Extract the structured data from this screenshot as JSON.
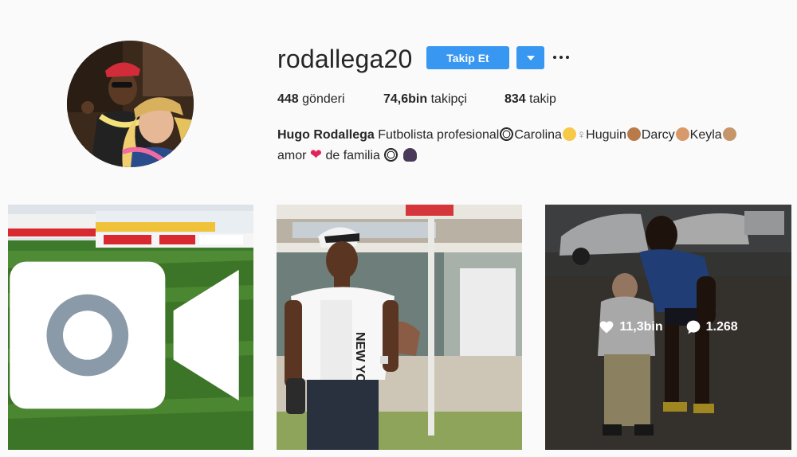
{
  "profile": {
    "username": "rodallega20",
    "follow_label": "Takip Et",
    "stats": {
      "posts_count": "448",
      "posts_label": "gönderi",
      "followers_count": "74,6bin",
      "followers_label": "takipçi",
      "following_count": "834",
      "following_label": "takip"
    },
    "bio": {
      "name": "Hugo Rodallega",
      "text1": "Futbolista profesional",
      "n1": "Carolina",
      "n2": "Huguin",
      "n3": "Darcy",
      "n4": "Keyla",
      "text2": "amor",
      "text3": "de familia"
    }
  },
  "posts": [
    {
      "type": "video",
      "icon": "video-icon"
    },
    {
      "type": "photo"
    },
    {
      "type": "photo",
      "hovered": true,
      "likes": "11,3bin",
      "comments": "1.268"
    }
  ],
  "colors": {
    "accent": "#3897f0",
    "background": "#fafafa",
    "text": "#262626"
  }
}
